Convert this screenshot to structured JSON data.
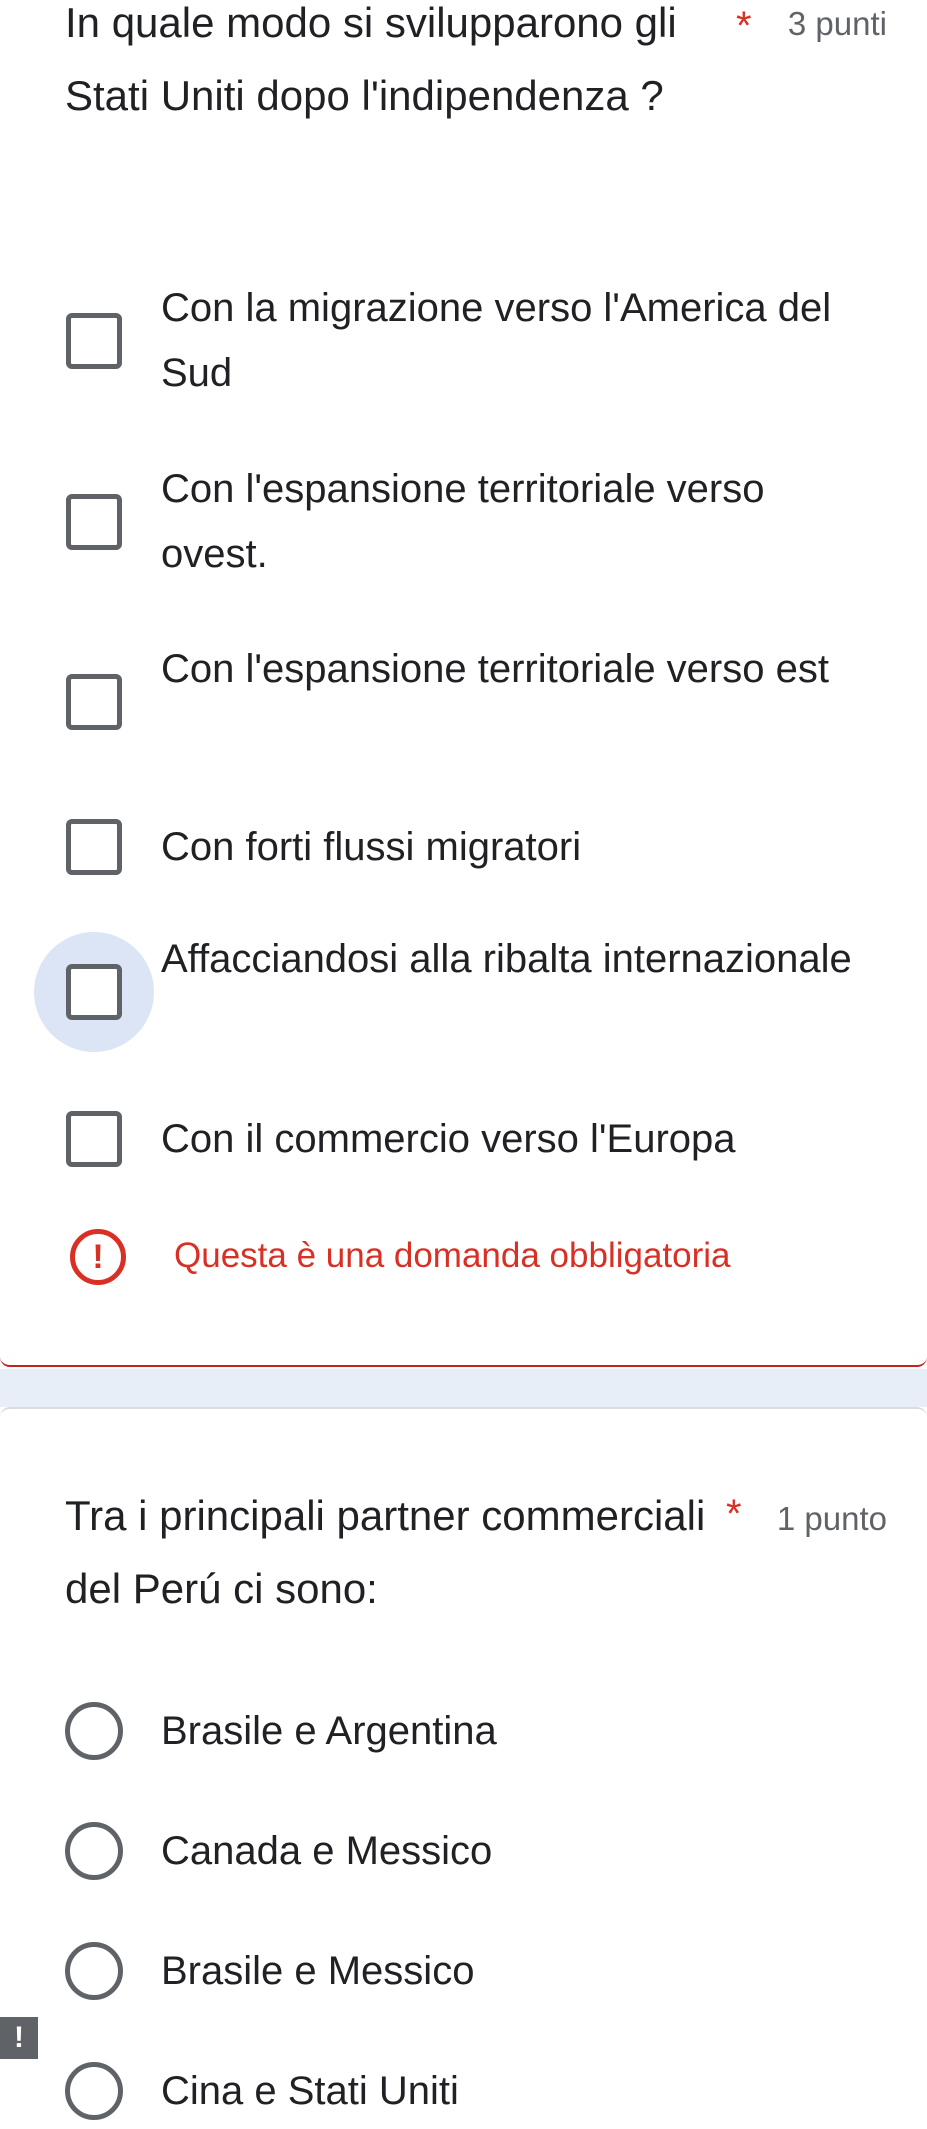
{
  "question1": {
    "title": "In quale modo si svilupparono gli Stati Uniti dopo l'indipendenza ?",
    "required_mark": "*",
    "points": "3 punti",
    "options": [
      {
        "label": "Con la migrazione verso l'America del Sud"
      },
      {
        "label": "Con l'espansione territoriale verso ovest."
      },
      {
        "label": "Con l'espansione territoriale verso est"
      },
      {
        "label": "Con forti flussi migratori"
      },
      {
        "label": "Affacciandosi alla ribalta internazionale"
      },
      {
        "label": "Con il commercio verso l'Europa"
      }
    ],
    "error_icon": "!",
    "error_text": "Questa è una domanda obbligatoria"
  },
  "question2": {
    "title": "Tra i principali partner commerciali del Perú ci sono:",
    "required_mark": "*",
    "points": "1 punto",
    "options": [
      {
        "label": "Brasile e Argentina"
      },
      {
        "label": "Canada e Messico"
      },
      {
        "label": "Brasile e Messico"
      },
      {
        "label": "Cina e Stati Uniti"
      }
    ]
  },
  "side_marker": "!",
  "colors": {
    "accent_error": "#d93025",
    "control_border": "#5f6368",
    "hover_halo": "#dbe5f6",
    "background_band": "#e8eef8"
  }
}
